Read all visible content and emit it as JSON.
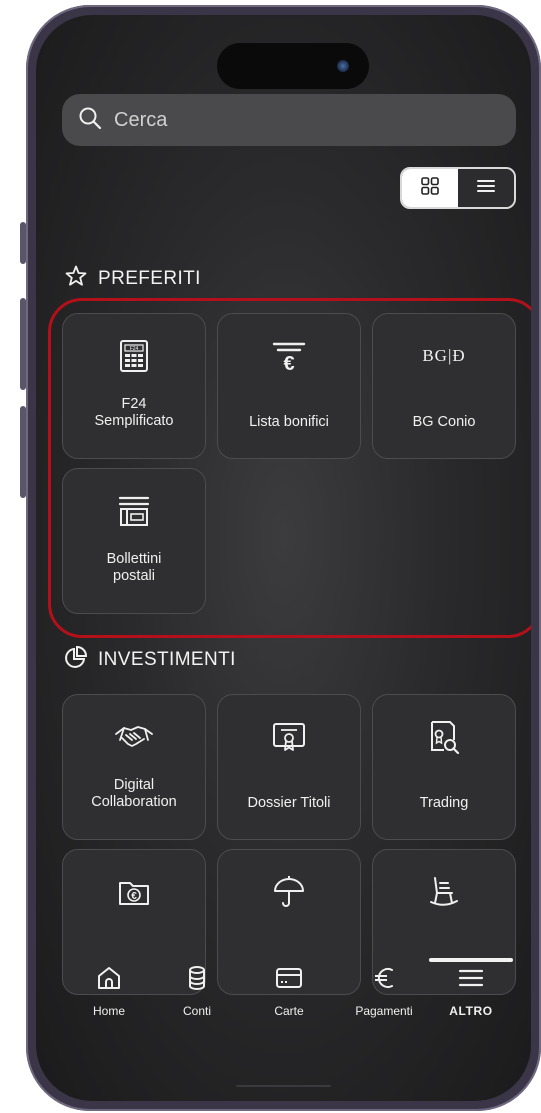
{
  "search": {
    "placeholder": "Cerca"
  },
  "view_toggle": {
    "grid_icon": "grid-icon",
    "list_icon": "list-icon",
    "active": "grid"
  },
  "favorites": {
    "title": "PREFERITI",
    "icon": "star-outline-icon",
    "items": [
      {
        "label": "F24\nSemplificato",
        "icon": "f24-form-icon"
      },
      {
        "label": "Lista bonifici",
        "icon": "euro-list-icon"
      },
      {
        "label": "BG Conio",
        "icon": "bg-conio-logo-icon"
      },
      {
        "label": "Bollettini\npostali",
        "icon": "postal-slip-icon"
      }
    ]
  },
  "investments": {
    "title": "INVESTIMENTI",
    "icon": "pie-chart-icon",
    "items": [
      {
        "label": "Digital\nCollaboration",
        "icon": "handshake-icon"
      },
      {
        "label": "Dossier Titoli",
        "icon": "certificate-icon"
      },
      {
        "label": "Trading",
        "icon": "document-search-icon"
      },
      {
        "label": "",
        "icon": "euro-folder-icon"
      },
      {
        "label": "",
        "icon": "umbrella-icon"
      },
      {
        "label": "",
        "icon": "rocking-chair-icon"
      }
    ]
  },
  "bg_conio_logo_text": "BG|Ð",
  "tabbar": {
    "items": [
      {
        "label": "Home",
        "icon": "home-icon"
      },
      {
        "label": "Conti",
        "icon": "coins-stack-icon"
      },
      {
        "label": "Carte",
        "icon": "card-icon"
      },
      {
        "label": "Pagamenti",
        "icon": "euro-icon"
      },
      {
        "label": "ALTRO",
        "icon": "menu-icon",
        "active": true
      }
    ]
  },
  "colors": {
    "highlight": "#b3101a",
    "background": "#2a2a2c",
    "tile": "#2f2f31"
  }
}
